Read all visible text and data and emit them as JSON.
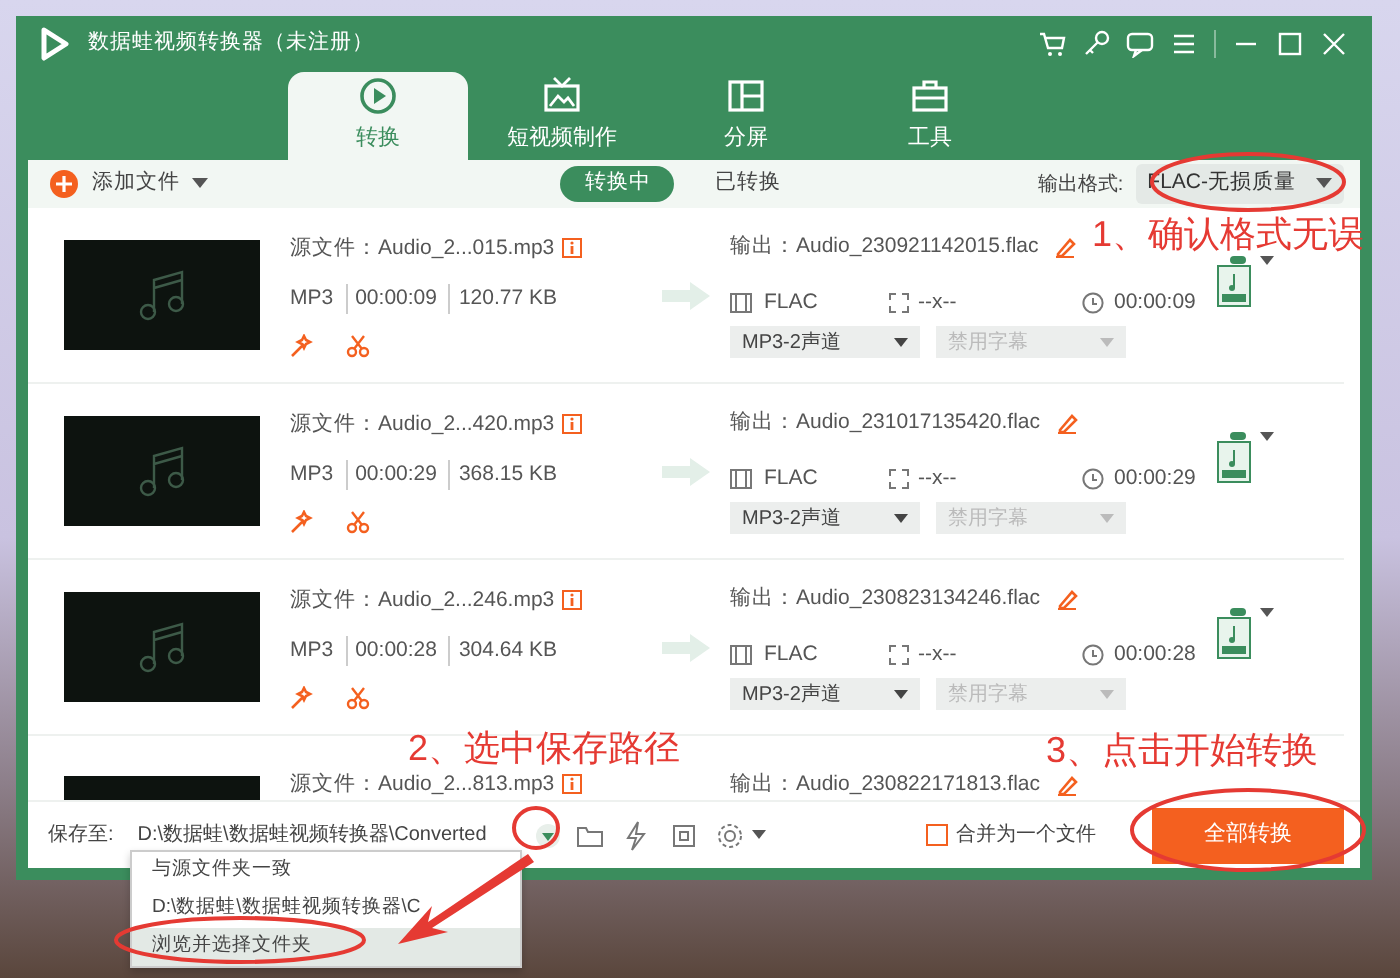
{
  "window": {
    "title": "数据蛙视频转换器（未注册）"
  },
  "tabs": [
    {
      "label": "转换",
      "selected": true
    },
    {
      "label": "短视频制作",
      "selected": false
    },
    {
      "label": "分屏",
      "selected": false
    },
    {
      "label": "工具",
      "selected": false
    }
  ],
  "toolbar": {
    "add_file": "添加文件",
    "filters": [
      {
        "label": "转换中",
        "selected": true
      },
      {
        "label": "已转换",
        "selected": false
      }
    ],
    "output_format_label": "输出格式:",
    "output_format": "FLAC-无损质量"
  },
  "files": [
    {
      "source_label": "源文件：",
      "source": "Audio_2...015.mp3",
      "format": "MP3",
      "duration": "00:00:09",
      "size": "120.77 KB",
      "output_label": "输出：",
      "output": "Audio_230921142015.flac",
      "out_format": "FLAC",
      "resolution": "--x--",
      "out_duration": "00:00:09",
      "audio_track": "MP3-2声道",
      "subtitle": "禁用字幕",
      "subtitle_disabled": true
    },
    {
      "source_label": "源文件：",
      "source": "Audio_2...420.mp3",
      "format": "MP3",
      "duration": "00:00:29",
      "size": "368.15 KB",
      "output_label": "输出：",
      "output": "Audio_231017135420.flac",
      "out_format": "FLAC",
      "resolution": "--x--",
      "out_duration": "00:00:29",
      "audio_track": "MP3-2声道",
      "subtitle": "禁用字幕",
      "subtitle_disabled": true
    },
    {
      "source_label": "源文件：",
      "source": "Audio_2...246.mp3",
      "format": "MP3",
      "duration": "00:00:28",
      "size": "304.64 KB",
      "output_label": "输出：",
      "output": "Audio_230823134246.flac",
      "out_format": "FLAC",
      "resolution": "--x--",
      "out_duration": "00:00:28",
      "audio_track": "MP3-2声道",
      "subtitle": "禁用字幕",
      "subtitle_disabled": true
    }
  ],
  "partial_file": {
    "source_label": "源文件：",
    "source": "Audio_2...813.mp3",
    "output_label": "输出：",
    "output": "Audio_230822171813.flac"
  },
  "bottom_bar": {
    "save_label": "保存至:",
    "save_path": "D:\\数据蛙\\数据蛙视频转换器\\Converted",
    "merge_label": "合并为一个文件",
    "merge_checked": false,
    "convert_all": "全部转换"
  },
  "path_menu": [
    {
      "label": "与源文件夹一致",
      "selected": false
    },
    {
      "label": "D:\\数据蛙\\数据蛙视频转换器\\C",
      "selected": false
    },
    {
      "label": "浏览并选择文件夹",
      "selected": true
    }
  ],
  "annotations": [
    "1、确认格式无误",
    "2、选中保存路径",
    "3、点击开始转换"
  ]
}
